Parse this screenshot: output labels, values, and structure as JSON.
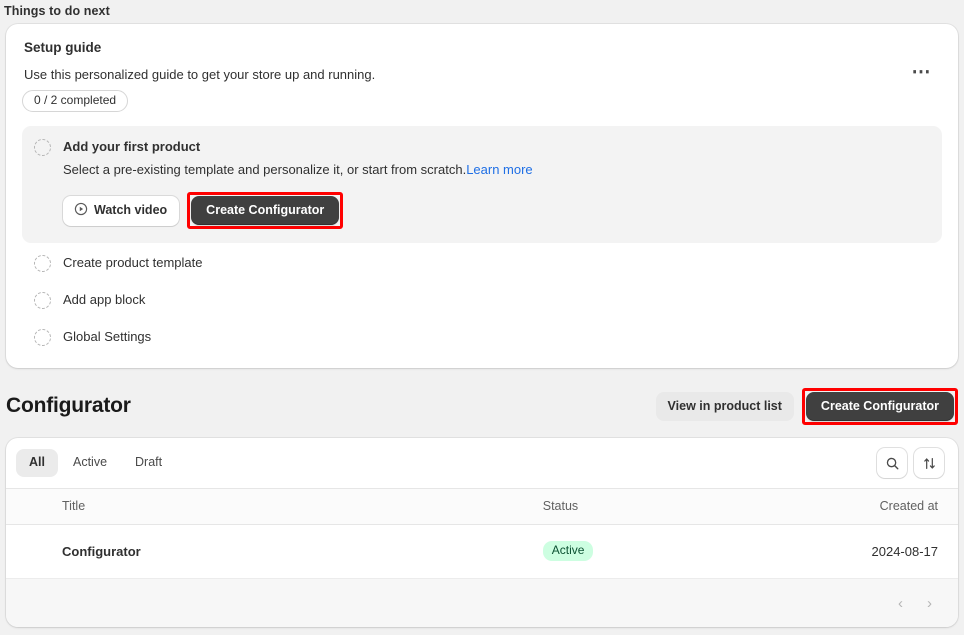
{
  "page": {
    "section_heading": "Things to do next"
  },
  "setup_guide": {
    "title": "Setup guide",
    "description": "Use this personalized guide to get your store up and running.",
    "progress_badge": "0 / 2 completed",
    "menu_icon": "ellipsis-horizontal-icon",
    "tasks": [
      {
        "title": "Add your first product",
        "description_text": "Select a pre-existing template and personalize it, or start from scratch.",
        "description_link": "Learn more",
        "watch_video_label": "Watch video",
        "primary_label": "Create Configurator",
        "state": "active",
        "icon": "dashed-circle-icon"
      },
      {
        "title": "Create product template",
        "state": "idle",
        "icon": "dashed-circle-icon"
      },
      {
        "title": "Add app block",
        "state": "idle",
        "icon": "dashed-circle-icon"
      },
      {
        "title": "Global Settings",
        "state": "idle",
        "icon": "dashed-circle-icon"
      }
    ]
  },
  "configurator": {
    "title": "Configurator",
    "view_in_product_list_label": "View in product list",
    "create_label": "Create Configurator",
    "tabs": [
      {
        "label": "All",
        "selected": true
      },
      {
        "label": "Active",
        "selected": false
      },
      {
        "label": "Draft",
        "selected": false
      }
    ],
    "tools": {
      "search_icon": "search-icon",
      "sort_icon": "sort-arrows-icon"
    },
    "table": {
      "columns": [
        "Title",
        "Status",
        "Created at"
      ],
      "rows": [
        {
          "title": "Configurator",
          "status": "Active",
          "created_at": "2024-08-17"
        }
      ]
    },
    "pagination": {
      "prev": "‹",
      "next": "›"
    }
  },
  "colors": {
    "page_background": "#f1f1f1",
    "card_background": "#ffffff",
    "dark_button": "#404040",
    "highlight_outline": "#ff0000",
    "link": "#1f6fe5",
    "badge_active_bg": "#cdfee1",
    "badge_active_text": "#0c5132"
  }
}
